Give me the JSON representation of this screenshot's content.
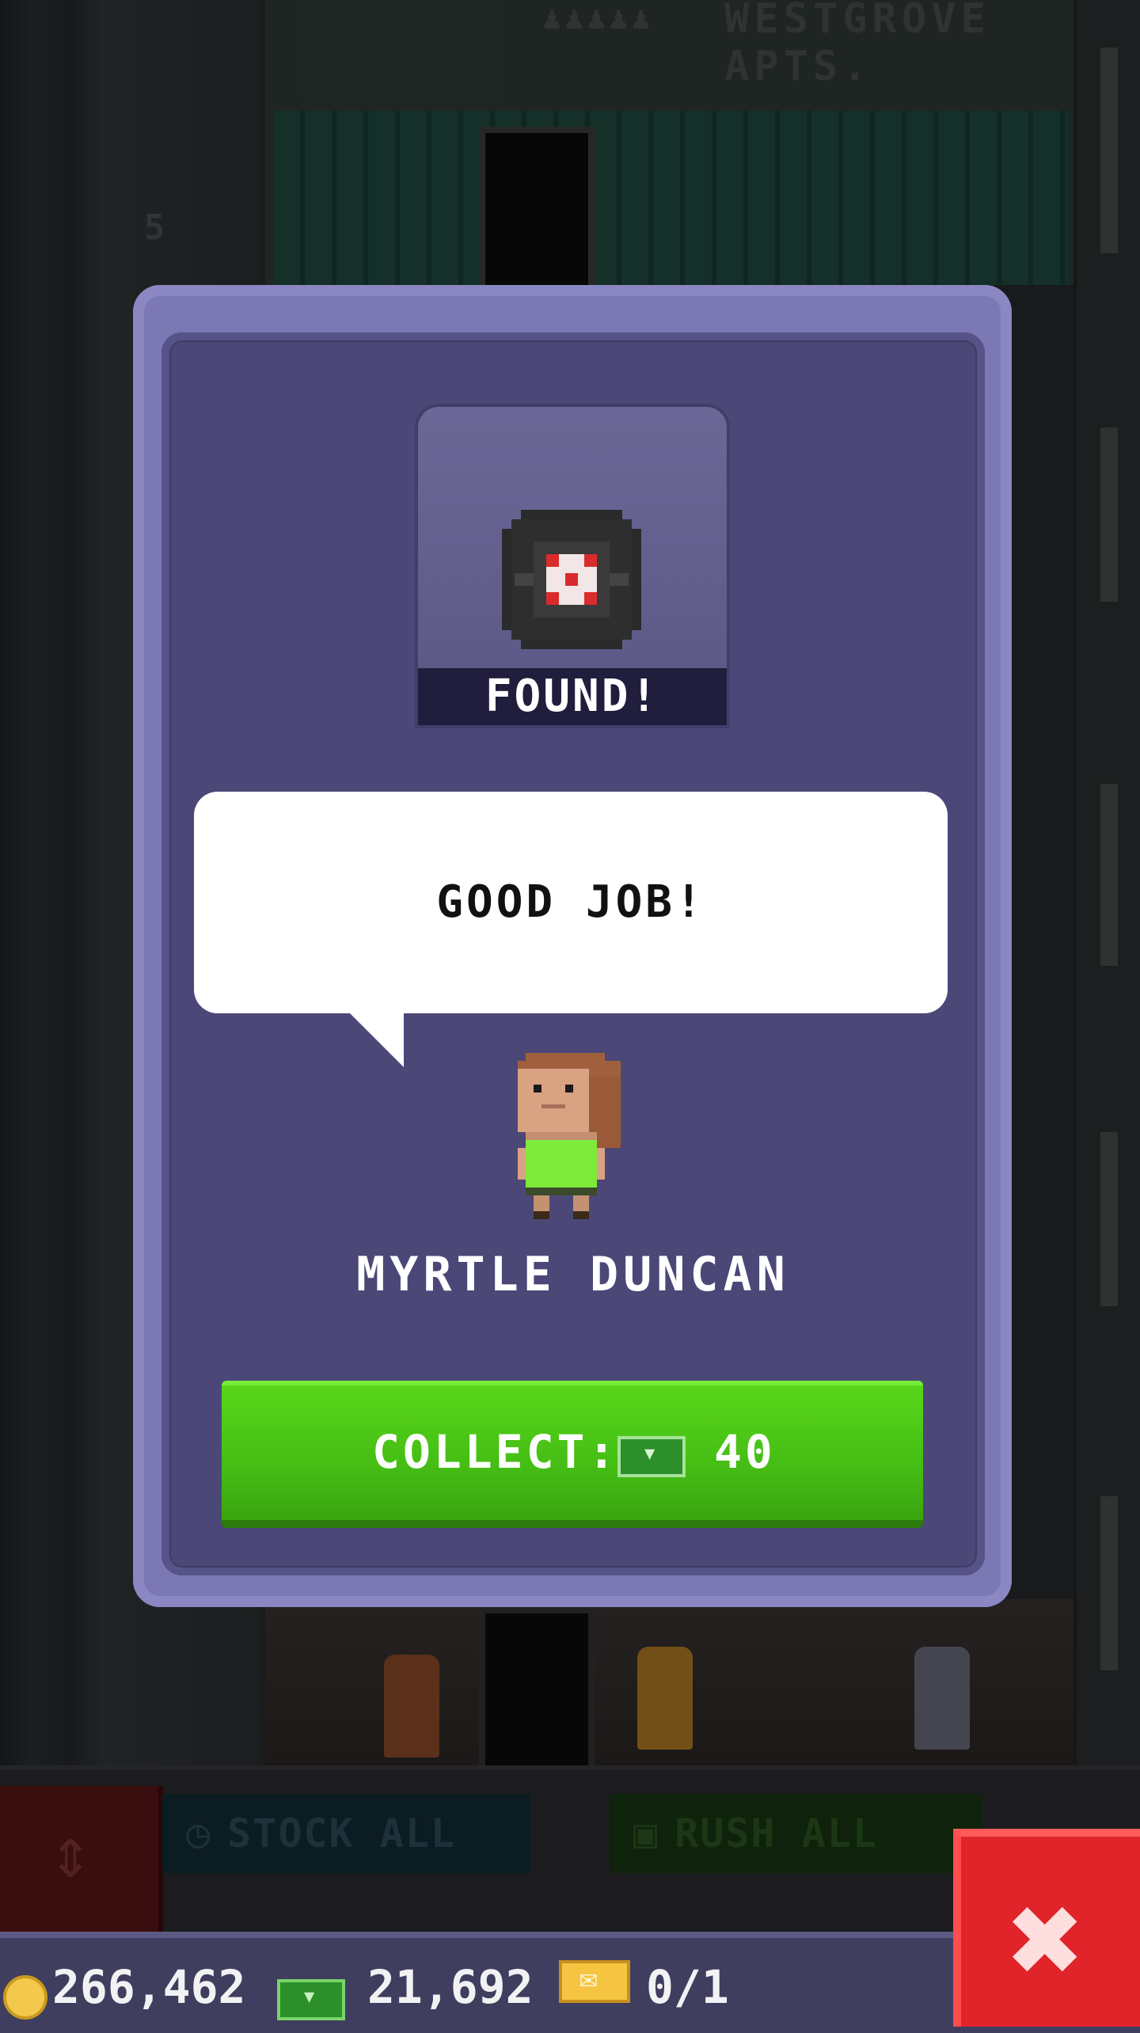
{
  "building": {
    "floor_name": "WESTGROVE APTS.",
    "floor_number": "5"
  },
  "dialog": {
    "item_status": "FOUND!",
    "speech": "GOOD JOB!",
    "npc_name": "MYRTLE DUNCAN",
    "collect_label": "COLLECT:",
    "collect_amount": "40",
    "collect_currency_icon": "bux-icon"
  },
  "toolbar": {
    "stock_all_label": "STOCK ALL",
    "rush_all_label": "RUSH ALL"
  },
  "status": {
    "coins": "266,462",
    "bux": "21,692",
    "tickets": "0/1"
  },
  "colors": {
    "dialog_frame": "#7c78b4",
    "dialog_panel": "#4b4878",
    "collect_green": "#45bd14",
    "close_red": "#e0242a"
  }
}
